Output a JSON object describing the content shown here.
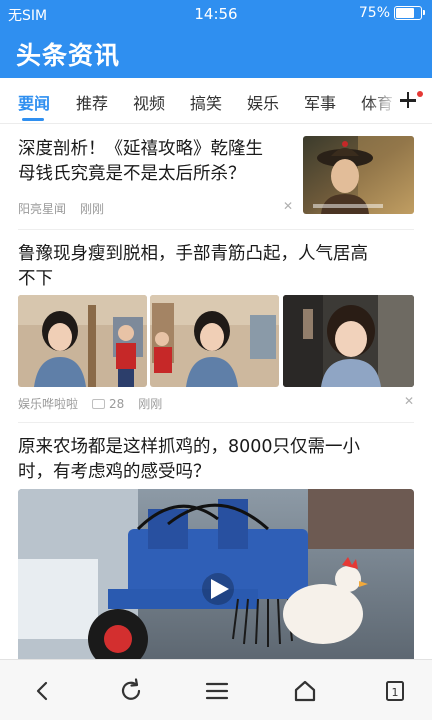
{
  "status": {
    "carrier": "无SIM",
    "time": "14:56",
    "battery": "75%",
    "battery_level": 0.75
  },
  "header": {
    "title": "头条资讯"
  },
  "tabs": [
    {
      "label": "要闻",
      "active": true
    },
    {
      "label": "推荐"
    },
    {
      "label": "视频"
    },
    {
      "label": "搞笑"
    },
    {
      "label": "娱乐"
    },
    {
      "label": "军事"
    },
    {
      "label": "体育"
    }
  ],
  "articles": [
    {
      "title_line1": "深度剖析！《延禧攻略》乾隆生",
      "title_line2": "母钱氏究竟是不是太后所杀？",
      "source": "阳亮星闻",
      "time": "刚刚"
    },
    {
      "title_line1": "鲁豫现身瘦到脱相，手部青筋凸起，人气居高",
      "title_line2": "不下",
      "source": "娱乐哗啦啦",
      "comments": "28",
      "time": "刚刚"
    },
    {
      "title_line1": "原来农场都是这样抓鸡的，8000只仅需一小",
      "title_line2": "时，有考虑鸡的感受吗？"
    }
  ],
  "colors": {
    "brand": "#2f8ff0",
    "badge": "#e53935"
  },
  "bottom_nav": [
    "back-icon",
    "refresh-icon",
    "menu-icon",
    "home-icon",
    "tabs-icon"
  ],
  "tab_count": "1"
}
